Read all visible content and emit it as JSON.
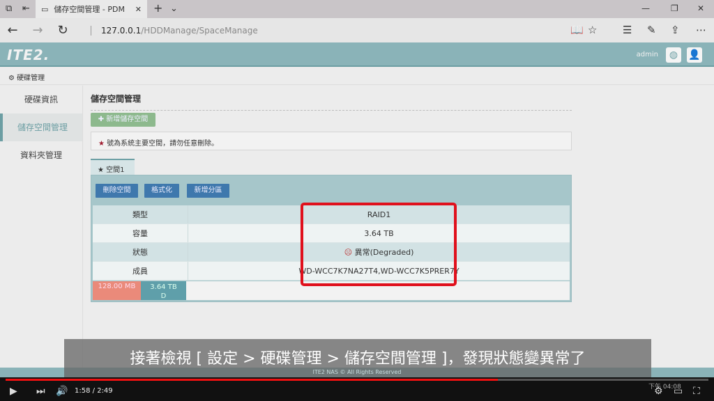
{
  "browser": {
    "tab_title": "儲存空間管理 - PDM",
    "url_host": "127.0.0.1",
    "url_path": "/HDDManage/SpaceManage"
  },
  "header": {
    "logo": "ITE2.",
    "user": "admin"
  },
  "breadcrumb": "硬碟管理",
  "sidebar": {
    "items": [
      {
        "label": "硬碟資訊"
      },
      {
        "label": "儲存空間管理",
        "active": true
      },
      {
        "label": "資料夾管理"
      }
    ]
  },
  "main": {
    "title": "儲存空間管理",
    "add_button": "新增儲存空間",
    "note": "號為系統主要空間，請勿任意刪除。",
    "space_tab": "空間1",
    "buttons": {
      "delete": "刪除空間",
      "format": "格式化",
      "add_partition": "新增分區"
    },
    "rows": [
      {
        "label": "類型",
        "value": "RAID1"
      },
      {
        "label": "容量",
        "value": "3.64 TB"
      },
      {
        "label": "狀態",
        "value": "異常(Degraded)"
      },
      {
        "label": "成員",
        "value": "WD-WCC7K7NA27T4,WD-WCC7K5PRER7Y"
      }
    ],
    "usage": {
      "seg1": "128.00 MB",
      "seg2_size": "3.64 TB",
      "seg2_label": "D"
    }
  },
  "footer": "ITE2 NAS © All Rights Reserved",
  "subtitle": "接著檢視 [ 設定 > 硬碟管理 > 儲存空間管理 ]，發現狀態變異常了",
  "player": {
    "current": "1:58",
    "duration": "2:49",
    "progress": 0.7,
    "clock": "下午 04:08"
  },
  "colors": {
    "accent": "#8ab3b8",
    "button": "#3f78ad",
    "highlight": "#e0101c"
  }
}
